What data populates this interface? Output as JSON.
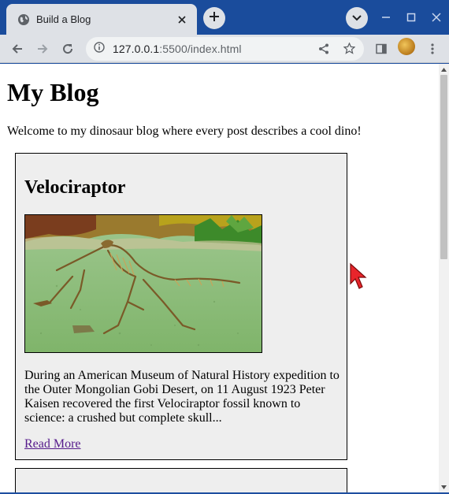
{
  "browser": {
    "tab_title": "Build a Blog",
    "url_host": "127.0.0.1",
    "url_rest": ":5500/index.html",
    "icons": [
      "globe-icon",
      "close-icon",
      "plus-icon",
      "chevron-down-icon",
      "minimize-icon",
      "maximize-icon",
      "window-close-icon",
      "back-icon",
      "forward-icon",
      "reload-icon",
      "info-icon",
      "share-icon",
      "star-icon",
      "side-panel-icon",
      "menu-icon"
    ],
    "accent_color": "#1a4c9c"
  },
  "page": {
    "title": "My Blog",
    "intro": "Welcome to my dinosaur blog where every post describes a cool dino!",
    "posts": [
      {
        "title": "Velociraptor",
        "image_subject": "velociraptor-skeleton",
        "text": "During an American Museum of Natural History expedition to the Outer Mongolian Gobi Desert, on 11 August 1923 Peter Kaisen recovered the first Velociraptor fossil known to science: a crushed but complete skull...",
        "link": "Read More"
      }
    ]
  }
}
